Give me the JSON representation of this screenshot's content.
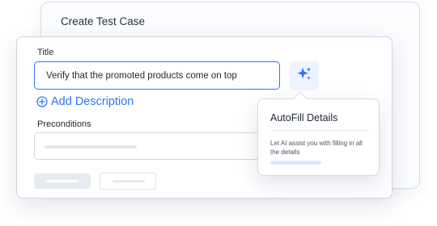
{
  "back_card": {
    "title": "Create Test Case"
  },
  "form": {
    "title_label": "Title",
    "title_value": "Verify that the promoted products come on top",
    "add_description_label": "Add Description",
    "preconditions_label": "Preconditions"
  },
  "popover": {
    "title": "AutoFill Details",
    "description": "Let AI assist you with filling in all the details"
  },
  "icons": {
    "autofill": "sparkle-icon",
    "add": "plus-circle-icon"
  },
  "colors": {
    "accent": "#2f74ff",
    "accent_soft": "#eef4ff"
  }
}
